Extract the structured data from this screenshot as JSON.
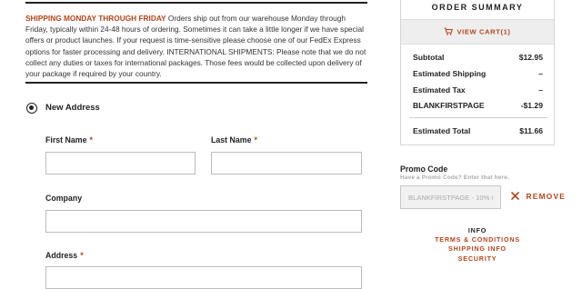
{
  "notice": {
    "heading": "SHIPPING MONDAY THROUGH FRIDAY",
    "body": "Orders ship out from our warehouse Monday through Friday, typically within 24-48 hours of ordering. Sometimes it can take a little longer if we have special offers or product launches. If your request is time-sensitive please choose one of our FedEx Express options for faster processing and delivery. INTERNATIONAL SHIPMENTS: Please note that we do not collect any duties or taxes for international packages. Those fees would be collected upon delivery of your package if required by your country."
  },
  "address": {
    "option_label": "New Address",
    "required_mark": "*",
    "first_name": {
      "label": "First Name",
      "value": ""
    },
    "last_name": {
      "label": "Last Name",
      "value": ""
    },
    "company": {
      "label": "Company",
      "value": ""
    },
    "address": {
      "label": "Address",
      "value": ""
    }
  },
  "summary": {
    "title": "ORDER SUMMARY",
    "view_cart": "VIEW CART(1)",
    "rows": [
      {
        "label": "Subtotal",
        "value": "$12.95"
      },
      {
        "label": "Estimated Shipping",
        "value": "–"
      },
      {
        "label": "Estimated Tax",
        "value": "–"
      },
      {
        "label": "BLANKFIRSTPAGE",
        "value": "-$1.29"
      }
    ],
    "total": {
      "label": "Estimated Total",
      "value": "$11.66"
    }
  },
  "promo": {
    "label": "Promo Code",
    "hint": "Have a Promo Code? Enter that here.",
    "value": "BLANKFIRSTPAGE - 10% Of",
    "remove": "REMOVE"
  },
  "footer": {
    "info": "INFO",
    "links": [
      "TERMS & CONDITIONS",
      "SHIPPING INFO",
      "SECURITY"
    ]
  },
  "icons": {
    "cart": "shopping-cart-icon",
    "remove": "close-x-icon"
  },
  "colors": {
    "accent": "#b5451b",
    "text": "#222222",
    "border": "#bdbdbd",
    "muted": "#aaaaaa"
  }
}
